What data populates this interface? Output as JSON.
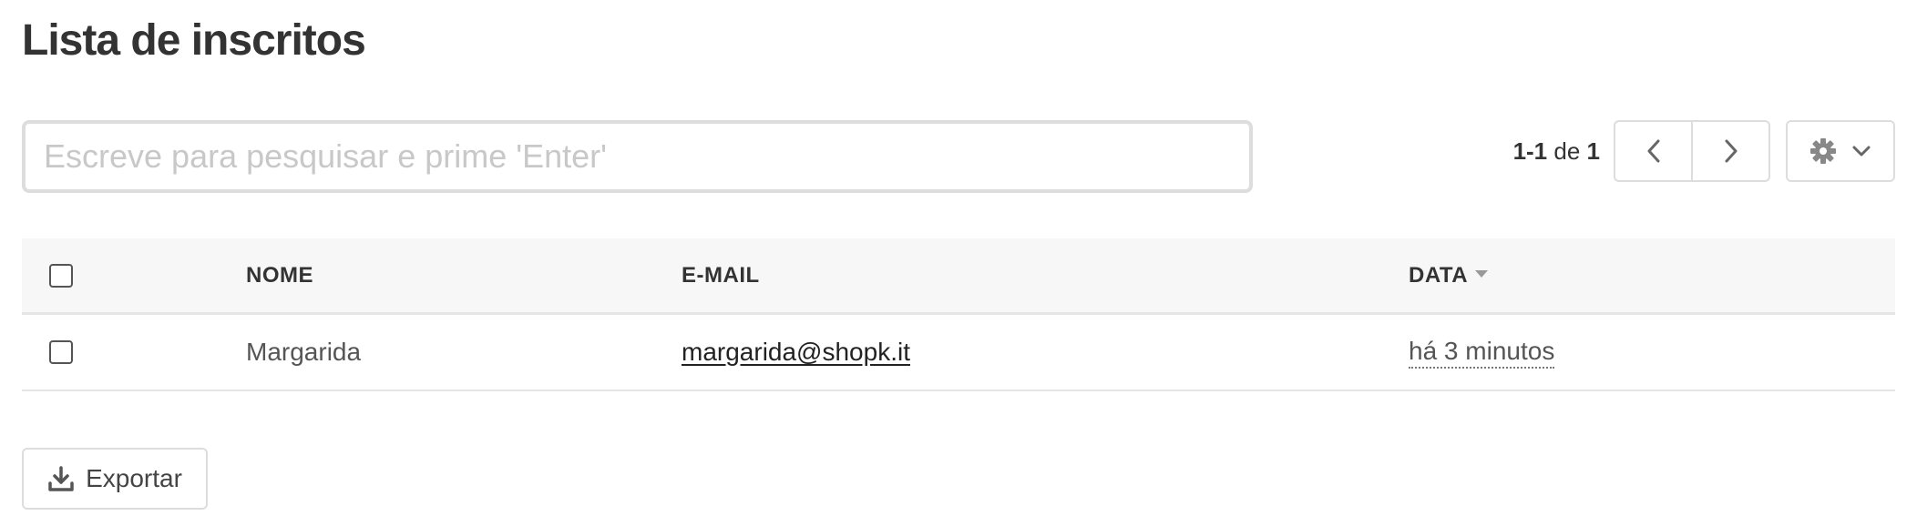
{
  "page": {
    "title": "Lista de inscritos"
  },
  "search": {
    "placeholder": "Escreve para pesquisar e prime 'Enter'",
    "value": ""
  },
  "pagination": {
    "range": "1-1",
    "of_label": "de",
    "total": "1"
  },
  "toolbar": {
    "settings_icon": "gear-icon",
    "dropdown_icon": "chevron-down-icon",
    "prev_icon": "chevron-left-icon",
    "next_icon": "chevron-right-icon"
  },
  "table": {
    "columns": [
      "NOME",
      "E-MAIL",
      "DATA"
    ],
    "sort_column": "DATA",
    "sort_direction": "desc",
    "rows": [
      {
        "name": "Margarida",
        "email": "margarida@shopk.it",
        "date": "há 3 minutos"
      }
    ]
  },
  "footer": {
    "export_label": "Exportar",
    "export_icon": "download-icon"
  },
  "colors": {
    "text": "#333333",
    "border": "#dddddd",
    "header_bg": "#f7f7f7",
    "placeholder": "#c8c8c8",
    "icon": "#666666"
  }
}
